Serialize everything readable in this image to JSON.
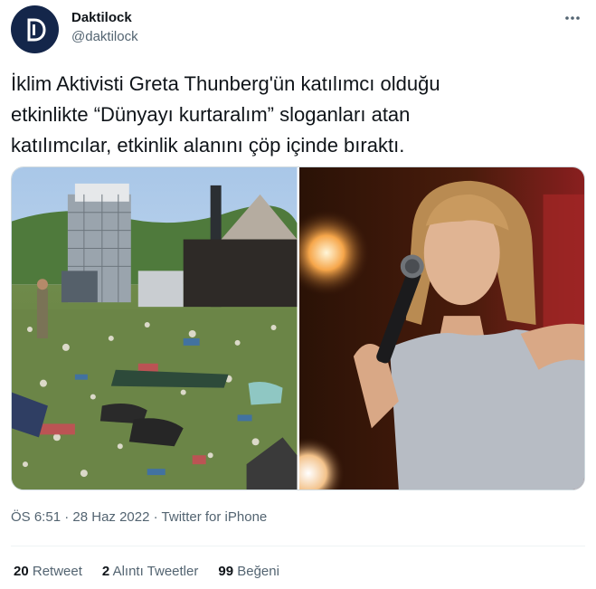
{
  "author": {
    "display_name": "Daktilock",
    "handle": "@daktilock",
    "avatar_letter": "D",
    "avatar_color": "#14264a"
  },
  "more_icon": "more-horizontal-icon",
  "tweet": {
    "text": "İklim Aktivisti Greta Thunberg'ün katılımcı olduğu\netkinlikte “Dünyayı kurtaralım” sloganları atan\nkatılımcılar, etkinlik alanını çöp içinde bıraktı."
  },
  "meta": {
    "time": "ÖS 6:51",
    "separator": " · ",
    "date": "28 Haz 2022",
    "source": "Twitter for iPhone"
  },
  "stats": {
    "retweets_count": "20",
    "retweets_label": "Retweet",
    "quotes_count": "2",
    "quotes_label": "Alıntı Tweetler",
    "likes_count": "99",
    "likes_label": "Beğeni"
  },
  "colors": {
    "text_primary": "#0f1419",
    "text_secondary": "#536471",
    "divider": "#eff3f4"
  }
}
